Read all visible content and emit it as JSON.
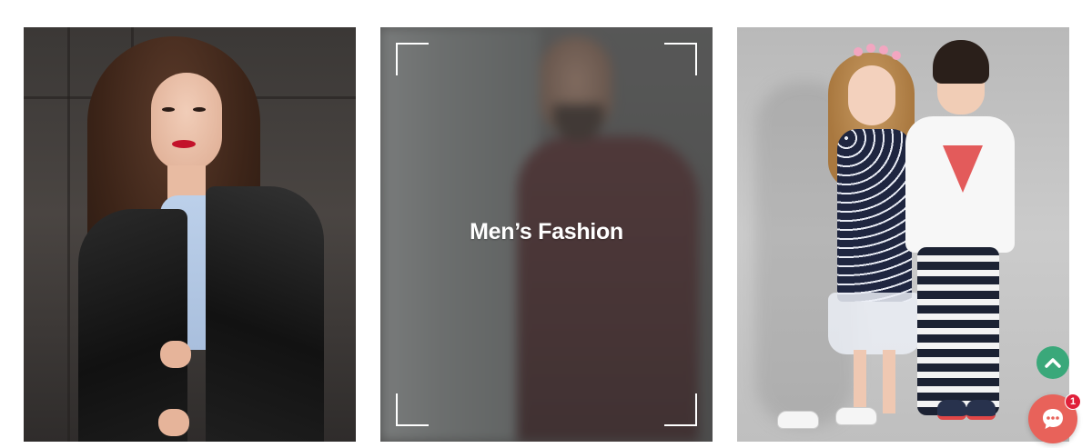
{
  "categories": [
    {
      "id": "women",
      "title": "",
      "image_alt": "woman-in-leather-jacket"
    },
    {
      "id": "men",
      "title": "Men’s Fashion",
      "image_alt": "man-in-burgundy-jacket"
    },
    {
      "id": "kids",
      "title": "",
      "image_alt": "two-children-standing"
    }
  ],
  "floating": {
    "scroll_top_icon": "chevron-up-icon",
    "chat_icon": "chat-bubble-icon",
    "chat_badge": "1"
  },
  "colors": {
    "scroll_top_bg": "#3aa87a",
    "chat_bg": "#e8625a",
    "badge_bg": "#e0203a",
    "overlay_text": "#ffffff"
  }
}
